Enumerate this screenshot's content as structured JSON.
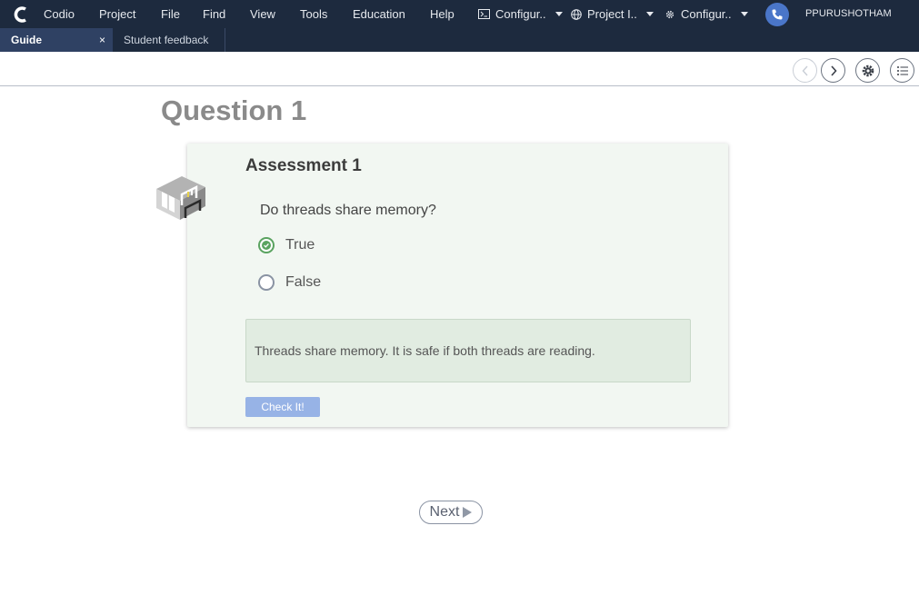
{
  "menubar": {
    "items": [
      "Codio",
      "Project",
      "File",
      "Find",
      "View",
      "Tools",
      "Education",
      "Help"
    ],
    "dropdowns": [
      {
        "label": "Configur..",
        "icon": "terminal-icon"
      },
      {
        "label": "Project I..",
        "icon": "globe-icon"
      },
      {
        "label": "Configur..",
        "icon": "gear-icon"
      }
    ],
    "user": "PPURUSHOTHAM"
  },
  "tabs": {
    "active": "Guide",
    "close": "×",
    "second": "Student feedback"
  },
  "content": {
    "question_title": "Question 1",
    "assessment_title": "Assessment 1",
    "question": "Do threads share memory?",
    "options": [
      {
        "label": "True",
        "selected": true
      },
      {
        "label": "False",
        "selected": false
      }
    ],
    "feedback": "Threads share memory. It is safe if both threads are reading.",
    "check_button": "Check It!",
    "next_button": "Next"
  },
  "colors": {
    "menubar_bg": "#1d2a3e",
    "active_tab_bg": "#2f4163",
    "card_bg": "#f2f7f2",
    "feedback_bg": "#e1ece1",
    "check_button_bg": "#97b3e6",
    "selected_radio": "#5aa360"
  }
}
